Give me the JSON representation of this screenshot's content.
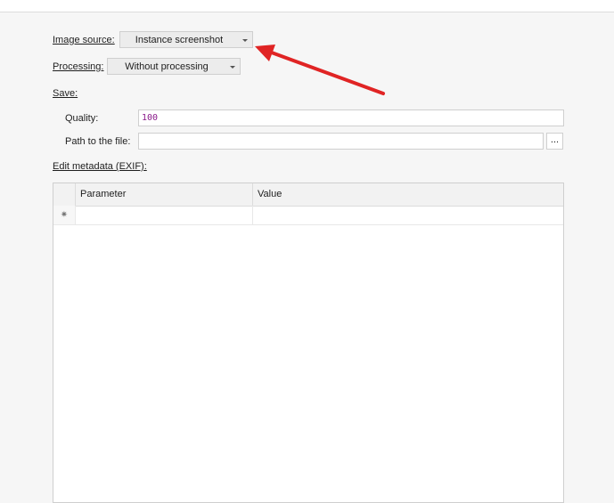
{
  "form": {
    "image_source": {
      "label": "Image source:",
      "value": "Instance screenshot"
    },
    "processing": {
      "label": "Processing:",
      "value": "Without processing"
    },
    "save": {
      "label": "Save:",
      "quality_label": "Quality:",
      "quality_value": "100",
      "path_label": "Path to the file:",
      "path_value": "",
      "browse_label": "..."
    },
    "metadata": {
      "label": "Edit metadata (EXIF):",
      "columns": [
        "Parameter",
        "Value"
      ],
      "new_row_icon": "asterisk-icon",
      "new_row_glyph": "✷"
    }
  },
  "annotation": {
    "arrow_color": "#e02424"
  }
}
